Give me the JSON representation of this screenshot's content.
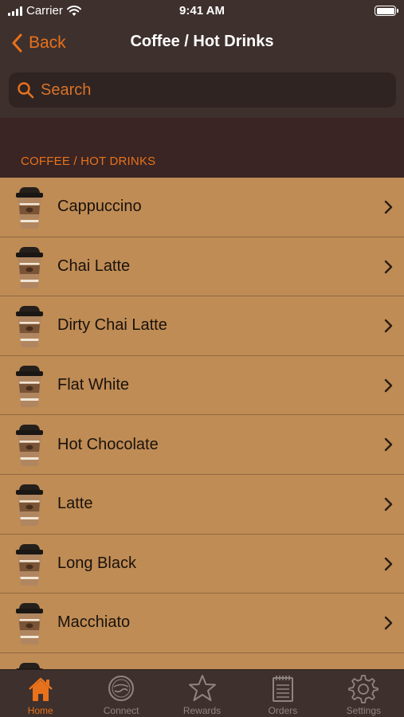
{
  "status_bar": {
    "carrier": "Carrier",
    "time": "9:41 AM"
  },
  "nav": {
    "back_label": "Back",
    "title": "Coffee / Hot Drinks"
  },
  "search": {
    "placeholder": "Search"
  },
  "section": {
    "title": "COFFEE / HOT DRINKS"
  },
  "items": [
    {
      "label": "Cappuccino"
    },
    {
      "label": "Chai Latte"
    },
    {
      "label": "Dirty Chai Latte"
    },
    {
      "label": "Flat White"
    },
    {
      "label": "Hot Chocolate"
    },
    {
      "label": "Latte"
    },
    {
      "label": "Long Black"
    },
    {
      "label": "Macchiato"
    }
  ],
  "tabs": [
    {
      "label": "Home",
      "icon": "home-icon",
      "active": true
    },
    {
      "label": "Connect",
      "icon": "connect-icon",
      "active": false
    },
    {
      "label": "Rewards",
      "icon": "star-icon",
      "active": false
    },
    {
      "label": "Orders",
      "icon": "notepad-icon",
      "active": false
    },
    {
      "label": "Settings",
      "icon": "gear-icon",
      "active": false
    }
  ],
  "colors": {
    "accent": "#e8721c",
    "list_background": "#bf8c55",
    "bar_background": "#3e302d",
    "section_background": "#3a2524"
  }
}
